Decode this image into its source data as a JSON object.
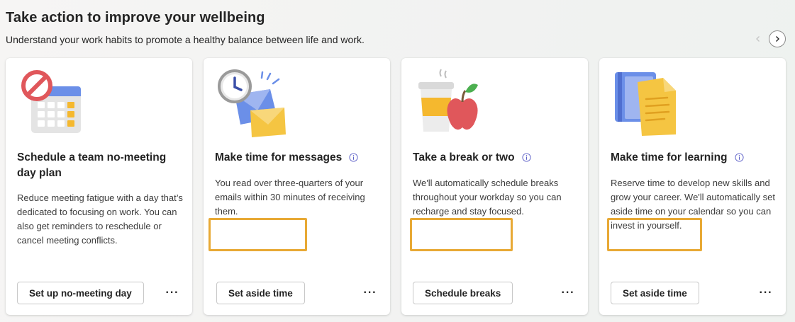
{
  "header": {
    "title": "Take action to improve your wellbeing",
    "subtitle": "Understand your work habits to promote a healthy balance between life and work."
  },
  "carousel": {
    "prev_icon": "chevron-left-icon",
    "next_icon": "chevron-right-icon"
  },
  "cards": [
    {
      "title": "Schedule a team no-meeting day plan",
      "description": "Reduce meeting fatigue with a day that’s dedicated to focusing on work. You can also get reminders to reschedule or cancel meeting conflicts.",
      "button_label": "Set up no-meeting day",
      "more_label": "···",
      "illustration": "calendar-no-meeting-icon",
      "has_info": false
    },
    {
      "title": "Make time for messages",
      "description": "You read over three-quarters of your emails within 30 minutes of receiving them.",
      "button_label": "Set aside time",
      "more_label": "···",
      "illustration": "clock-envelopes-icon",
      "has_info": true
    },
    {
      "title": "Take a break or two",
      "description": "We'll automatically schedule breaks throughout your workday so you can recharge and stay focused.",
      "button_label": "Schedule breaks",
      "more_label": "···",
      "illustration": "coffee-apple-icon",
      "has_info": true
    },
    {
      "title": "Make time for learning",
      "description": "Reserve time to develop new skills and grow your career. We'll automatically set aside time on your calendar so you can invest in yourself.",
      "button_label": "Set aside time",
      "more_label": "···",
      "illustration": "notebook-document-icon",
      "has_info": true
    }
  ],
  "colors": {
    "highlight": "#e8a935",
    "info_icon": "#5b5fc7"
  }
}
